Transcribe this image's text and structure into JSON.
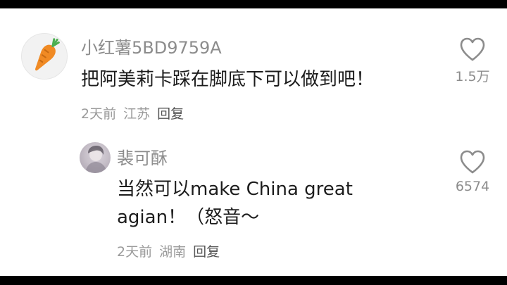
{
  "comments": [
    {
      "username": "小红薯5BD9759A",
      "text_lines": [
        "把阿美莉卡踩在脚底下可以做到吧！"
      ],
      "time": "2天前",
      "location": "江苏",
      "reply_label": "回复",
      "like_count": "1.5万",
      "avatar_icon": "carrot-icon"
    },
    {
      "username": "裴可酥",
      "text_lines": [
        "当然可以make China great",
        "agian！（怒音～"
      ],
      "time": "2天前",
      "location": "湖南",
      "reply_label": "回复",
      "like_count": "6574",
      "avatar_icon": "user-photo"
    }
  ],
  "colors": {
    "username": "#8c8c8c",
    "text": "#1c1c1c",
    "meta": "#9a9a9a",
    "carrot": "#f08a24"
  }
}
